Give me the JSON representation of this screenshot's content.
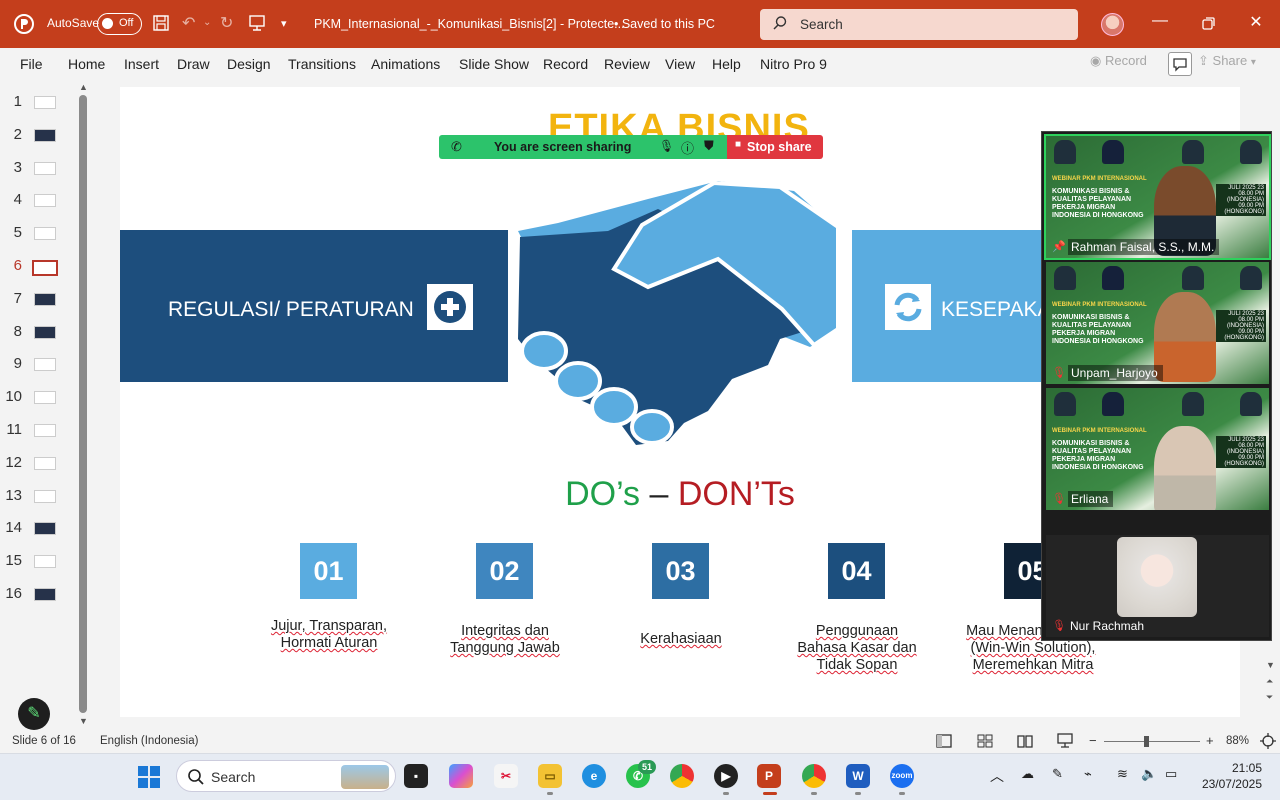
{
  "titlebar": {
    "autosave_label": "AutoSave",
    "autosave_state": "Off",
    "document_name": "PKM_Internasional_-_Komunikasi_Bisnis[2]  -  Protecte...",
    "save_status": "• Saved to this PC",
    "search_placeholder": "Search",
    "accent_color": "#c43e1c"
  },
  "ribbon": {
    "tabs": [
      "File",
      "Home",
      "Insert",
      "Draw",
      "Design",
      "Transitions",
      "Animations",
      "Slide Show",
      "Record",
      "Review",
      "View",
      "Help",
      "Nitro Pro 9"
    ],
    "record_label": "Record",
    "share_label": "Share"
  },
  "thumbnails": {
    "numbers": [
      "1",
      "2",
      "3",
      "4",
      "5",
      "6",
      "7",
      "8",
      "9",
      "10",
      "11",
      "12",
      "13",
      "14",
      "15",
      "16"
    ],
    "selected": "6"
  },
  "slide": {
    "title": "ETIKA BISNIS",
    "left_band_text": "REGULASI/ PERATURAN",
    "right_band_text": "KESEPAKA",
    "dos_do": "DO’s",
    "dos_dash": " – ",
    "dos_dont": "DON’Ts",
    "items": [
      {
        "num": "01",
        "lines": [
          "Jujur, Transparan,",
          "Hormati Aturan"
        ],
        "color": "#5aace0"
      },
      {
        "num": "02",
        "lines": [
          "Integritas dan",
          "Tanggung Jawab"
        ],
        "color": "#3f86bf"
      },
      {
        "num": "03",
        "lines": [
          "Kerahasiaan"
        ],
        "color": "#2d6ea3"
      },
      {
        "num": "04",
        "lines": [
          "Penggunaan",
          "Bahasa Kasar dan",
          "Tidak Sopan"
        ],
        "color": "#1c4f7e"
      },
      {
        "num": "05",
        "lines": [
          "Mau Menang Sendiri",
          "(Win-Win Solution),",
          "Meremehkan Mitra"
        ],
        "color": "#0f2236"
      }
    ]
  },
  "screenshare": {
    "message": "You are screen sharing",
    "stop_label": "Stop share"
  },
  "zoom": {
    "participants": [
      {
        "name": "Rahman Faisal, S.S., M.M."
      },
      {
        "name": "Unpam_Harjoyo"
      },
      {
        "name": "Erliana"
      },
      {
        "name": "Nur Rachmah"
      }
    ],
    "poster": {
      "tag": "WEBINAR PKM INTERNASIONAL",
      "title": "KOMUNIKASI BISNIS & KUALITAS PELAYANAN PEKERJA MIGRAN INDONESIA DI HONGKONG",
      "date": "JULI 2025 23 08.00 PM (INDONESIA) 09.00 PM (HONGKONG)"
    }
  },
  "statusbar": {
    "slide_info": "Slide 6 of 16",
    "language": "English (Indonesia)",
    "zoom": "88%"
  },
  "taskbar": {
    "search_label": "Search",
    "whatsapp_badge": "51",
    "time": "21:05",
    "date": "23/07/2025"
  }
}
